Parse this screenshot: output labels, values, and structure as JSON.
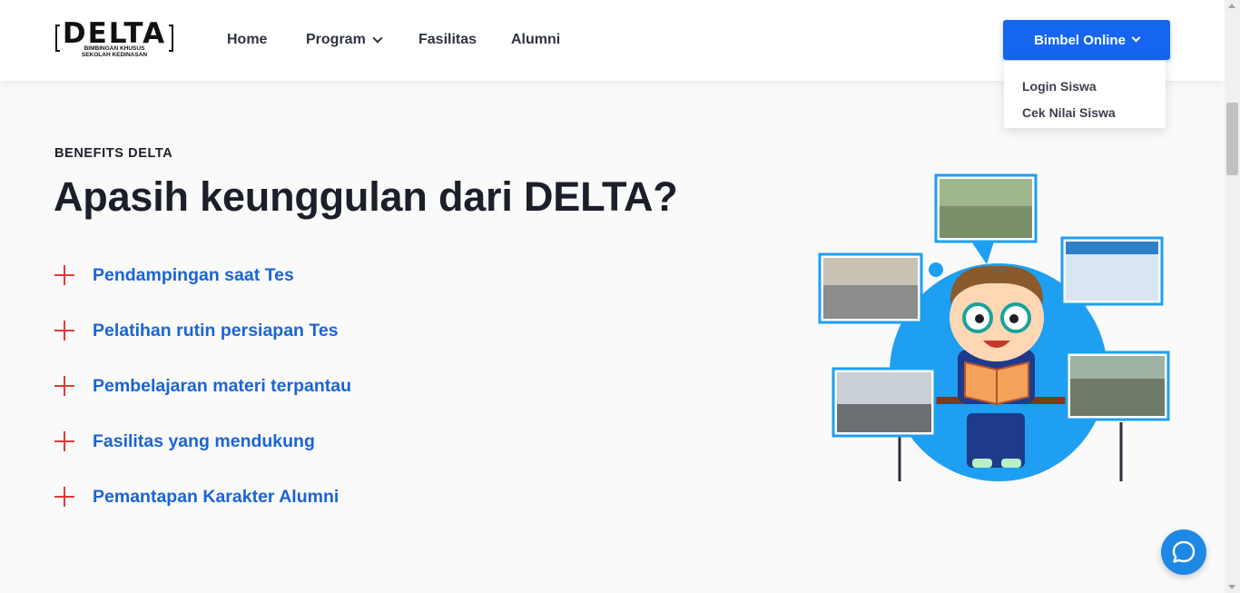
{
  "header": {
    "logo": {
      "word": "DELTA",
      "tagline_1": "BIMBINGAN KHUSUS",
      "tagline_2": "SEKOLAH KEDINASAN"
    },
    "nav": {
      "home": "Home",
      "program": "Program",
      "fasilitas": "Fasilitas",
      "alumni": "Alumni"
    },
    "cta": {
      "label": "Bimbel Online",
      "menu": [
        "Login Siswa",
        "Cek Nilai Siswa"
      ]
    }
  },
  "section": {
    "eyebrow": "BENEFITS DELTA",
    "title": "Apasih keunggulan dari DELTA?",
    "benefits": [
      "Pendampingan saat Tes",
      "Pelatihan rutin persiapan Tes",
      "Pembelajaran materi terpantau",
      "Fasilitas yang mendukung",
      "Pemantapan Karakter Alumni"
    ]
  },
  "colors": {
    "primary_blue": "#1565f0",
    "benefit_text": "#1a64d6",
    "plus_red": "#e53935",
    "illustration_blue": "#1e9ff2",
    "chat_blue": "#1e88e5"
  },
  "icons": {
    "benefit_marker": "plus-icon",
    "dropdown": "chevron-down-icon",
    "chat": "chat-bubble-icon"
  }
}
